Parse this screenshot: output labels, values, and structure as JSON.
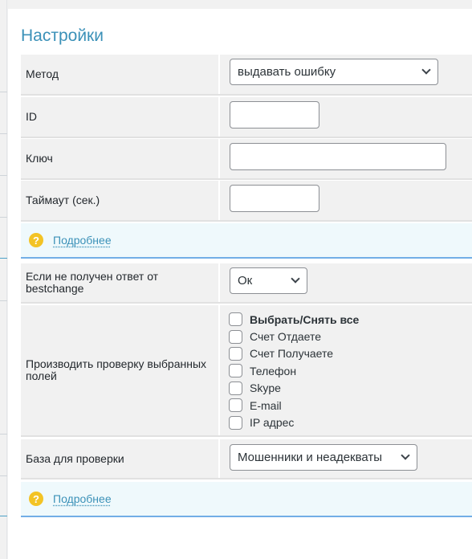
{
  "title": "Настройки",
  "method": {
    "label": "Метод",
    "value": "выдавать ошибку"
  },
  "id": {
    "label": "ID",
    "value": ""
  },
  "key": {
    "label": "Ключ",
    "value": ""
  },
  "timeout": {
    "label": "Таймаут (сек.)",
    "value": ""
  },
  "more1": {
    "label": "Подробнее"
  },
  "no_response": {
    "label": "Если не получен ответ от bestchange",
    "value": "Ок"
  },
  "check_fields": {
    "label": "Производить проверку выбранных полей",
    "items": [
      {
        "label": "Выбрать/Снять все",
        "checked": false
      },
      {
        "label": "Счет Отдаете",
        "checked": false
      },
      {
        "label": "Счет Получаете",
        "checked": false
      },
      {
        "label": "Телефон",
        "checked": false
      },
      {
        "label": "Skype",
        "checked": false
      },
      {
        "label": "E-mail",
        "checked": false
      },
      {
        "label": "IP адрес",
        "checked": false
      }
    ]
  },
  "database": {
    "label": "База для проверки",
    "value": "Мошенники и неадекваты"
  },
  "more2": {
    "label": "Подробнее"
  },
  "icons": {
    "info": "question-circle-icon",
    "dropdown": "chevron-down-icon"
  },
  "colors": {
    "accent": "#3b91b8",
    "info_bg": "#eff9fc",
    "info_border": "#72aee6",
    "help_icon": "#f3c325"
  }
}
